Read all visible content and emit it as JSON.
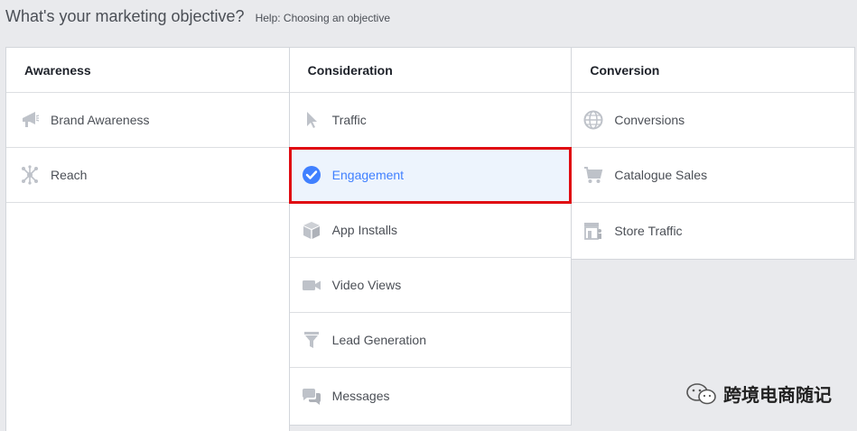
{
  "header": {
    "title": "What's your marketing objective?",
    "help": "Help: Choosing an objective"
  },
  "columns": {
    "awareness": {
      "title": "Awareness",
      "items": [
        "Brand Awareness",
        "Reach"
      ]
    },
    "consideration": {
      "title": "Consideration",
      "items": [
        "Traffic",
        "Engagement",
        "App Installs",
        "Video Views",
        "Lead Generation",
        "Messages"
      ]
    },
    "conversion": {
      "title": "Conversion",
      "items": [
        "Conversions",
        "Catalogue Sales",
        "Store Traffic"
      ]
    }
  },
  "selected": "Engagement",
  "colors": {
    "selected_text": "#4080ff",
    "selected_bg": "#edf4fd",
    "highlight_border": "#e00b12",
    "icon_gray": "#bec2c9"
  },
  "icons": {
    "brand_awareness": "megaphone-icon",
    "reach": "network-icon",
    "traffic": "cursor-icon",
    "engagement": "check-circle-icon",
    "app_installs": "box-icon",
    "video_views": "video-camera-icon",
    "lead_generation": "funnel-icon",
    "messages": "chat-bubbles-icon",
    "conversions": "globe-icon",
    "catalogue_sales": "cart-icon",
    "store_traffic": "store-icon"
  },
  "watermark": {
    "text": "跨境电商随记"
  }
}
